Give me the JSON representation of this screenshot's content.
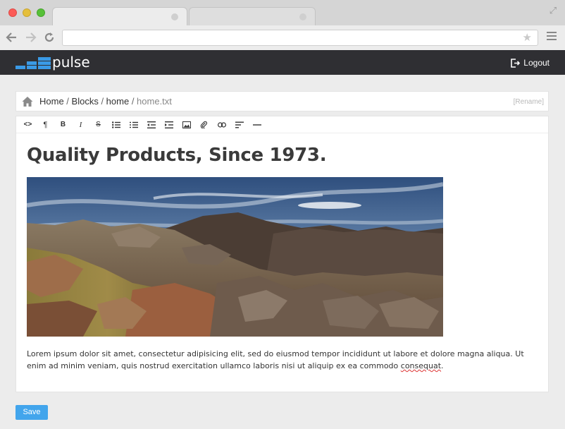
{
  "browser": {
    "star_glyph": "★",
    "expand_glyph": "⤢"
  },
  "app": {
    "logo_text": "pulse",
    "logout_label": "Logout",
    "colors": {
      "header_bg": "#2f2f33",
      "logo_blue": "#3a9ae6",
      "accent": "#42a5ec"
    }
  },
  "breadcrumb": {
    "items": [
      "Home",
      "Blocks",
      "home"
    ],
    "current": "home.txt",
    "separator": " / ",
    "rename_label": "[Rename]"
  },
  "editor": {
    "toolbar": [
      {
        "name": "code-view",
        "glyph": "<>"
      },
      {
        "name": "paragraph",
        "glyph": "¶"
      },
      {
        "name": "bold",
        "glyph": "B"
      },
      {
        "name": "italic",
        "glyph": "I"
      },
      {
        "name": "strikethrough",
        "glyph": "S"
      },
      {
        "name": "unordered-list",
        "icon": "ul-icon"
      },
      {
        "name": "ordered-list",
        "icon": "ol-icon"
      },
      {
        "name": "outdent",
        "icon": "outdent-icon"
      },
      {
        "name": "indent",
        "icon": "indent-icon"
      },
      {
        "name": "image",
        "icon": "image-icon"
      },
      {
        "name": "file",
        "icon": "paperclip-icon"
      },
      {
        "name": "link",
        "icon": "link-icon"
      },
      {
        "name": "alignment",
        "icon": "align-icon"
      },
      {
        "name": "horizontal-rule",
        "icon": "hr-icon"
      }
    ],
    "title": "Quality Products, Since 1973.",
    "body_text_before": "Lorem ipsum dolor sit amet, consectetur adipisicing elit, sed do eiusmod tempor incididunt ut labore et dolore magna aliqua. Ut enim ad minim veniam, quis nostrud exercitation ullamco laboris nisi ut aliquip ex ea commodo ",
    "body_text_misspelled": "consequat",
    "body_text_after": "."
  },
  "actions": {
    "save_label": "Save"
  }
}
